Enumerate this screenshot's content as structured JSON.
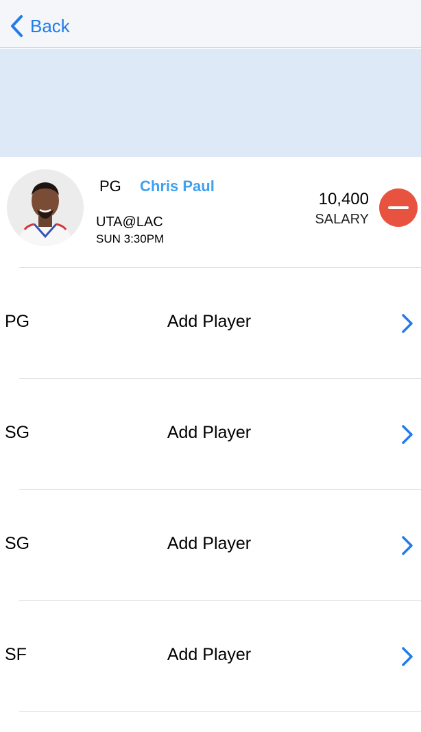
{
  "nav": {
    "back_label": "Back"
  },
  "selected_player": {
    "position": "PG",
    "name": "Chris Paul",
    "matchup": "UTA@LAC",
    "game_time": "SUN 3:30PM",
    "salary_value": "10,400",
    "salary_label": "SALARY",
    "remove_icon": "minus-circle-icon"
  },
  "slots": [
    {
      "position": "PG",
      "action": "Add Player",
      "icon": "chevron-right-icon"
    },
    {
      "position": "SG",
      "action": "Add Player",
      "icon": "chevron-right-icon"
    },
    {
      "position": "SG",
      "action": "Add Player",
      "icon": "chevron-right-icon"
    },
    {
      "position": "SF",
      "action": "Add Player",
      "icon": "chevron-right-icon"
    }
  ],
  "colors": {
    "accent": "#1f7cea",
    "player_name": "#3fa0ee",
    "remove": "#e85340",
    "banner": "#dde9f7"
  }
}
